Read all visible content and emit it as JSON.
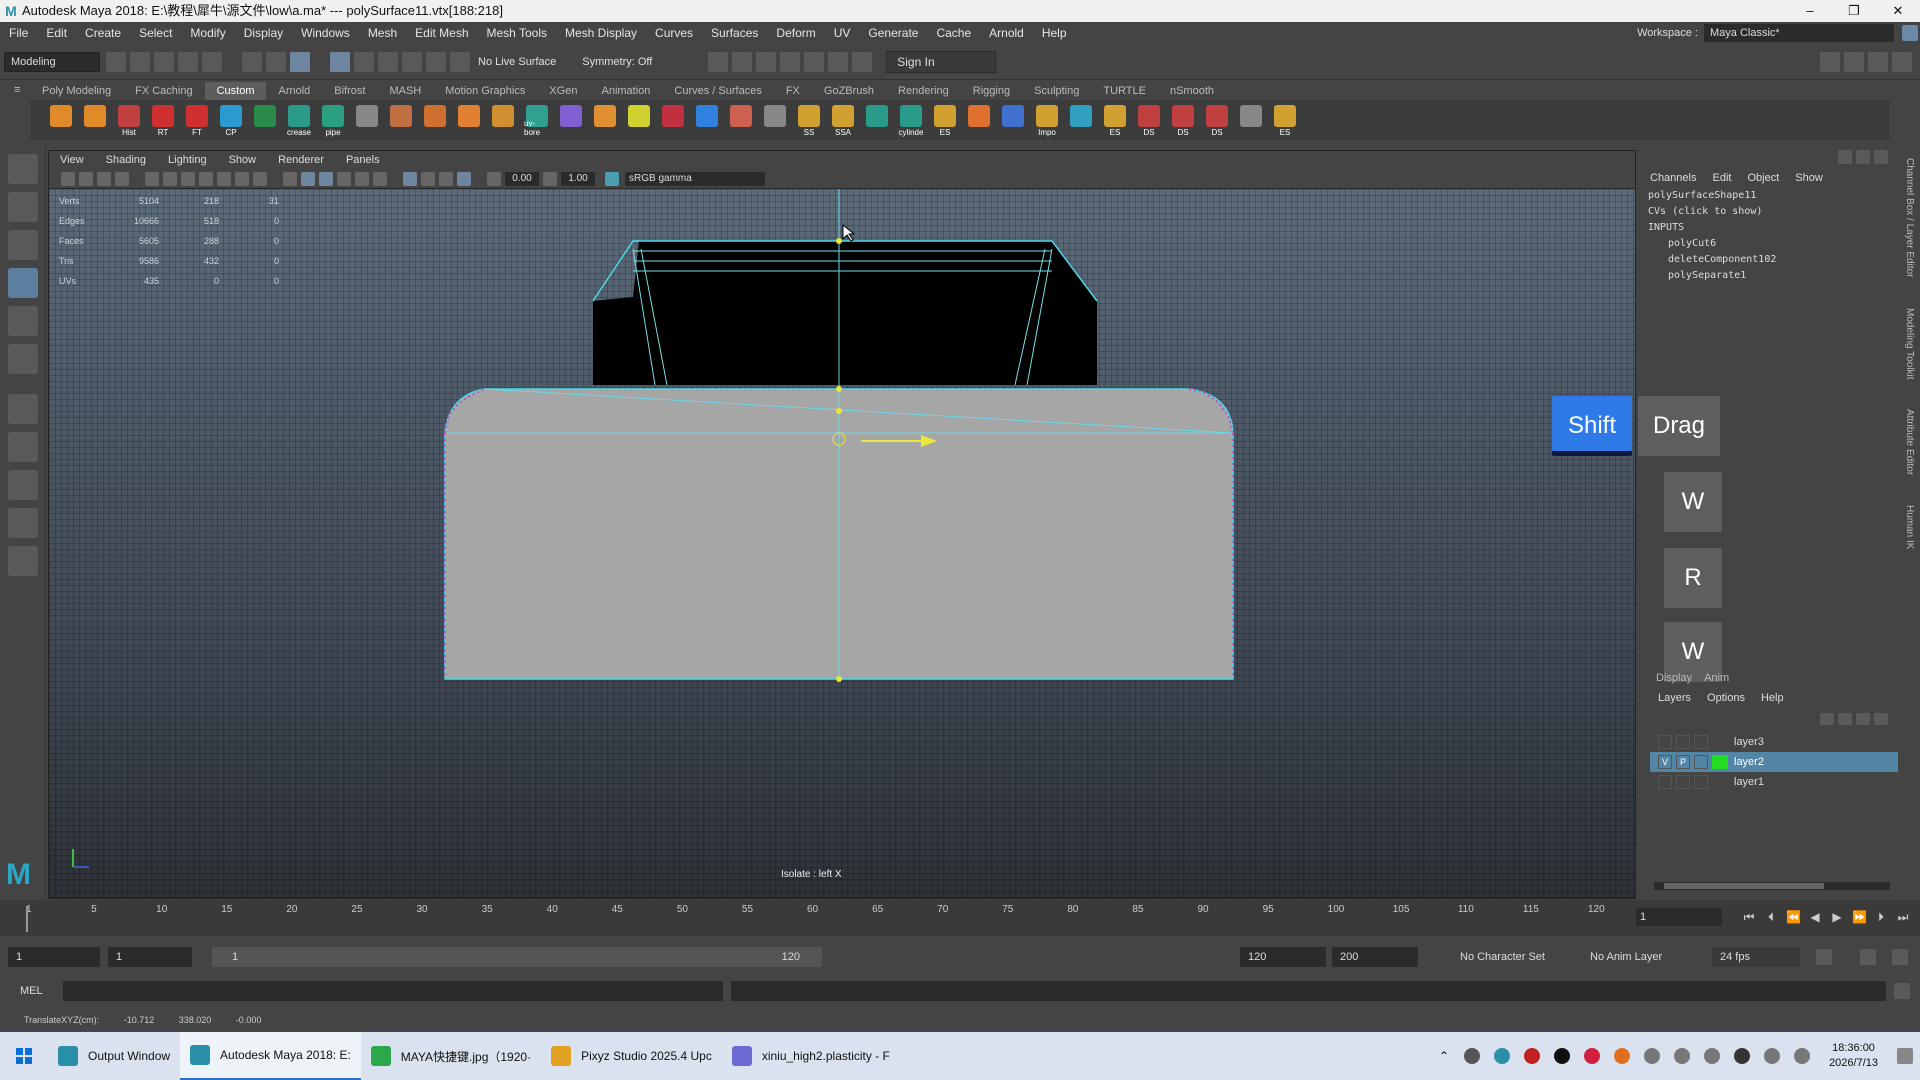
{
  "title": {
    "app_title": "Autodesk Maya 2018: E:\\教程\\犀牛\\源文件\\low\\a.ma*  ---  polySurface11.vtx[188:218]",
    "min": "–",
    "max": "❐",
    "close": "✕"
  },
  "menu": [
    "File",
    "Edit",
    "Create",
    "Select",
    "Modify",
    "Display",
    "Windows",
    "Mesh",
    "Edit Mesh",
    "Mesh Tools",
    "Mesh Display",
    "Curves",
    "Surfaces",
    "Deform",
    "UV",
    "Generate",
    "Cache",
    "Arnold",
    "Help"
  ],
  "workspace": {
    "label": "Workspace :",
    "value": "Maya Classic*"
  },
  "toolbar": {
    "mode": "Modeling",
    "live_surface": "No Live Surface",
    "symmetry": "Symmetry: Off",
    "sign_in": "Sign In"
  },
  "shelf_tabs": [
    "Poly Modeling",
    "FX Caching",
    "Custom",
    "Arnold",
    "Bifrost",
    "MASH",
    "Motion Graphics",
    "XGen",
    "Animation",
    "Curves / Surfaces",
    "FX",
    "GoZBrush",
    "Rendering",
    "Rigging",
    "Sculpting",
    "TURTLE",
    "nSmooth"
  ],
  "shelf_active": "Custom",
  "shelf_icons": [
    "",
    "",
    "Hist",
    "RT",
    "FT",
    "CP",
    "",
    "crease",
    "pipe",
    "",
    "",
    "",
    "",
    "",
    "uv-bore",
    "",
    "",
    "",
    "",
    "",
    "",
    "",
    "SS",
    "SSA",
    "",
    "cylinde",
    "ES",
    "",
    "",
    "Impo",
    "",
    "ES",
    "DS",
    "DS",
    "DS",
    "",
    "ES"
  ],
  "viewport_menu": [
    "View",
    "Shading",
    "Lighting",
    "Show",
    "Renderer",
    "Panels"
  ],
  "viewport_bar": {
    "val1": "0.00",
    "val2": "1.00",
    "colorspace": "sRGB gamma"
  },
  "hud": [
    {
      "k": "Verts",
      "a": "5104",
      "b": "218",
      "c": "31"
    },
    {
      "k": "Edges",
      "a": "10666",
      "b": "518",
      "c": "0"
    },
    {
      "k": "Faces",
      "a": "5605",
      "b": "288",
      "c": "0"
    },
    {
      "k": "Tris",
      "a": "9586",
      "b": "432",
      "c": "0"
    },
    {
      "k": "UVs",
      "a": "435",
      "b": "0",
      "c": "0"
    }
  ],
  "isolate_label": "Isolate : left X",
  "keys": {
    "shift": "Shift",
    "drag": "Drag",
    "w1": "W",
    "r": "R",
    "w2": "W"
  },
  "channels": {
    "menu": [
      "Channels",
      "Edit",
      "Object",
      "Show"
    ],
    "shape": "polySurfaceShape11",
    "cvs": "CVs (click to show)",
    "inputs": "INPUTS",
    "items": [
      "polyCut6",
      "deleteComponent102",
      "polySeparate1"
    ]
  },
  "layers": {
    "tabs": [
      "Display",
      "Anim"
    ],
    "menu": [
      "Layers",
      "Options",
      "Help"
    ],
    "rows": [
      {
        "name": "layer3",
        "v": "",
        "p": "",
        "color": "transparent"
      },
      {
        "name": "layer2",
        "v": "V",
        "p": "P",
        "color": "#22dd22"
      },
      {
        "name": "layer1",
        "v": "",
        "p": "",
        "color": "transparent"
      }
    ]
  },
  "side_tabs": [
    "Channel Box / Layer Editor",
    "Modeling Toolkit",
    "Attribute Editor",
    "Human IK"
  ],
  "timeline": {
    "ticks": [
      "1",
      "5",
      "10",
      "15",
      "20",
      "25",
      "30",
      "35",
      "40",
      "45",
      "50",
      "55",
      "60",
      "65",
      "70",
      "75",
      "80",
      "85",
      "90",
      "95",
      "100",
      "105",
      "110",
      "115",
      "120"
    ],
    "current_frame": "1"
  },
  "range": {
    "start": "1",
    "start2": "1",
    "slider_left": "1",
    "slider_right": "120",
    "end1": "120",
    "end2": "200",
    "char_set": "No Character Set",
    "anim_layer": "No Anim Layer",
    "fps": "24 fps"
  },
  "cmd": {
    "mel": "MEL"
  },
  "helpline": {
    "label": "TranslateXYZ(cm):",
    "x": "-10.712",
    "y": "338.020",
    "z": "-0.000"
  },
  "taskbar": {
    "tasks": [
      {
        "label": "Output Window",
        "color": "#2a8fa8"
      },
      {
        "label": "Autodesk Maya 2018: E:",
        "color": "#2a8fa8"
      },
      {
        "label": "MAYA快捷键.jpg（1920·",
        "color": "#2ca84a"
      },
      {
        "label": "Pixyz Studio 2025.4 Upc",
        "color": "#e0a020"
      },
      {
        "label": "xiniu_high2.plasticity - F",
        "color": "#6a6ad0"
      }
    ],
    "time": "18:36:00",
    "date": "2026/7/13"
  },
  "accent": "#2e7be8"
}
